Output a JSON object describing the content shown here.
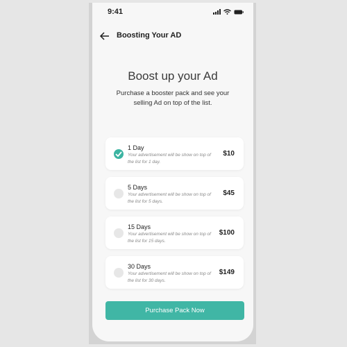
{
  "status_bar": {
    "time": "9:41"
  },
  "header": {
    "title": "Boosting Your AD",
    "back_icon": "arrow-left-icon"
  },
  "hero": {
    "title": "Boost up your Ad",
    "subtitle": "Purchase a booster pack and see your selling Ad on top of the list."
  },
  "packs": [
    {
      "title": "1 Day",
      "description": "Your advertisement will be show on top of the list for 1 day.",
      "price": "$10",
      "selected": true
    },
    {
      "title": "5 Days",
      "description": "Your advertisement will be show on top of the list for 5 days.",
      "price": "$45",
      "selected": false
    },
    {
      "title": "15 Days",
      "description": "Your advertisement will be show on top of the list for 15 days.",
      "price": "$100",
      "selected": false
    },
    {
      "title": "30 Days",
      "description": "Your advertisement will be show on top of the list for 30 days.",
      "price": "$149",
      "selected": false
    }
  ],
  "cta": {
    "label": "Purchase Pack Now"
  },
  "colors": {
    "accent": "#40b6a5",
    "background": "#f7f7f7",
    "card": "#ffffff"
  }
}
